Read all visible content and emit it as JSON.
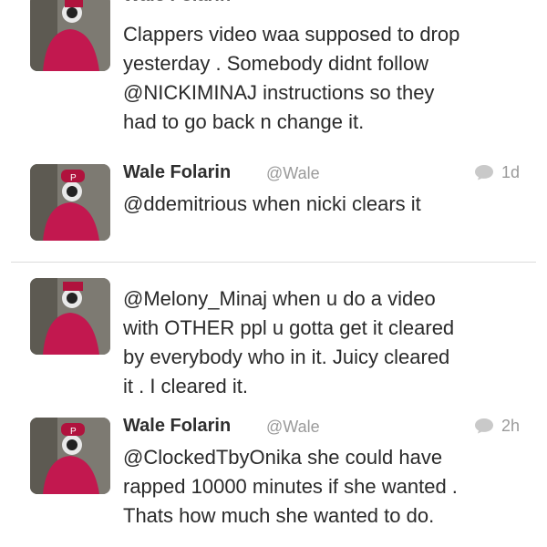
{
  "tweets": [
    {
      "name": "Wale Folarin",
      "handle": "@Wale",
      "time": "",
      "text": "Clappers video waa supposed to drop\nyesterday . Somebody didnt follow\n@NICKIMINAJ instructions so they\nhad to go back n change it."
    },
    {
      "name": "Wale Folarin",
      "handle": "@Wale",
      "time": "1d",
      "text": "@ddemitrious when nicki clears it"
    },
    {
      "name": "",
      "handle": "",
      "time": "",
      "text": "@Melony_Minaj when u do a video\nwith OTHER ppl u gotta get it cleared\nby everybody who in it. Juicy cleared\nit . I cleared it."
    },
    {
      "name": "Wale Folarin",
      "handle": "@Wale",
      "time": "2h",
      "text": "@ClockedTbyOnika she could have\nrapped 10000 minutes if she wanted .\nThats how much she wanted to do."
    }
  ],
  "icons": {
    "avatar": "avatar-image",
    "reply": "speech-bubble-icon"
  },
  "colors": {
    "secondary_text": "#9a9a9a",
    "divider": "#dcdcdc"
  }
}
